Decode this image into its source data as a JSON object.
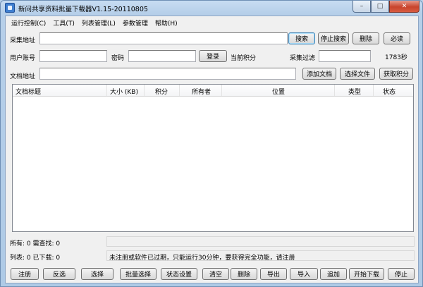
{
  "window": {
    "title": "新问共享资料批量下载器V1.15-20110805",
    "controls": {
      "minimize": "–",
      "maximize": "□",
      "close": "✕"
    }
  },
  "menu": [
    "运行控制(C)",
    "工具(T)",
    "列表管理(L)",
    "参数管理",
    "帮助(H)"
  ],
  "row1": {
    "collect_url_label": "采集地址",
    "collect_url_value": "",
    "search_button": "搜索",
    "stop_search_button": "停止搜索",
    "delete_button": "删除",
    "must_read_button": "必读"
  },
  "row2": {
    "user_label": "用户账号",
    "user_value": "",
    "password_label": "密码",
    "password_value": "",
    "login_button": "登录",
    "points_label": "当前积分",
    "points_value": "",
    "filter_label": "采集过滤",
    "filter_value": "",
    "seconds": "1783秒"
  },
  "row3": {
    "doc_url_label": "文档地址",
    "doc_url_value": "",
    "add_doc_button": "添加文档",
    "select_file_button": "选择文件",
    "get_points_button": "获取积分"
  },
  "table": {
    "columns": [
      "文档标题",
      "大小 (KB)",
      "积分",
      "所有者",
      "位置",
      "类型",
      "状态"
    ],
    "rows": []
  },
  "status": {
    "line1": "所有: 0 需查找: 0",
    "line2": "列表: 0 已下载: 0",
    "notice": "未注册或软件已过期，只能运行30分钟，要获得完全功能，请注册"
  },
  "bottom_buttons": [
    "注册",
    "反选",
    "选择",
    "批量选择",
    "状态设置",
    "清空",
    "删除",
    "导出",
    "导入",
    "追加",
    "开始下载",
    "停止"
  ]
}
